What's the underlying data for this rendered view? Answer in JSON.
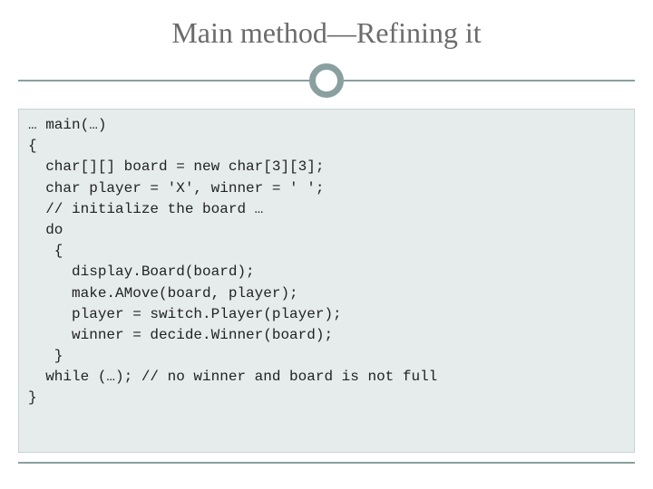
{
  "title": "Main method—Refining it",
  "code": {
    "l0": "… main(…)",
    "l1": "{",
    "l2": "  char[][] board = new char[3][3];",
    "l3": "  char player = 'X', winner = ' ';",
    "l4": "  // initialize the board …",
    "l5": "  do",
    "l6": "   {",
    "l7": "     display.Board(board);",
    "l8": "     make.AMove(board, player);",
    "l9": "     player = switch.Player(player);",
    "l10": "     winner = decide.Winner(board);",
    "l11": "   }",
    "l12": "  while (…); // no winner and board is not full",
    "l13": "}"
  }
}
